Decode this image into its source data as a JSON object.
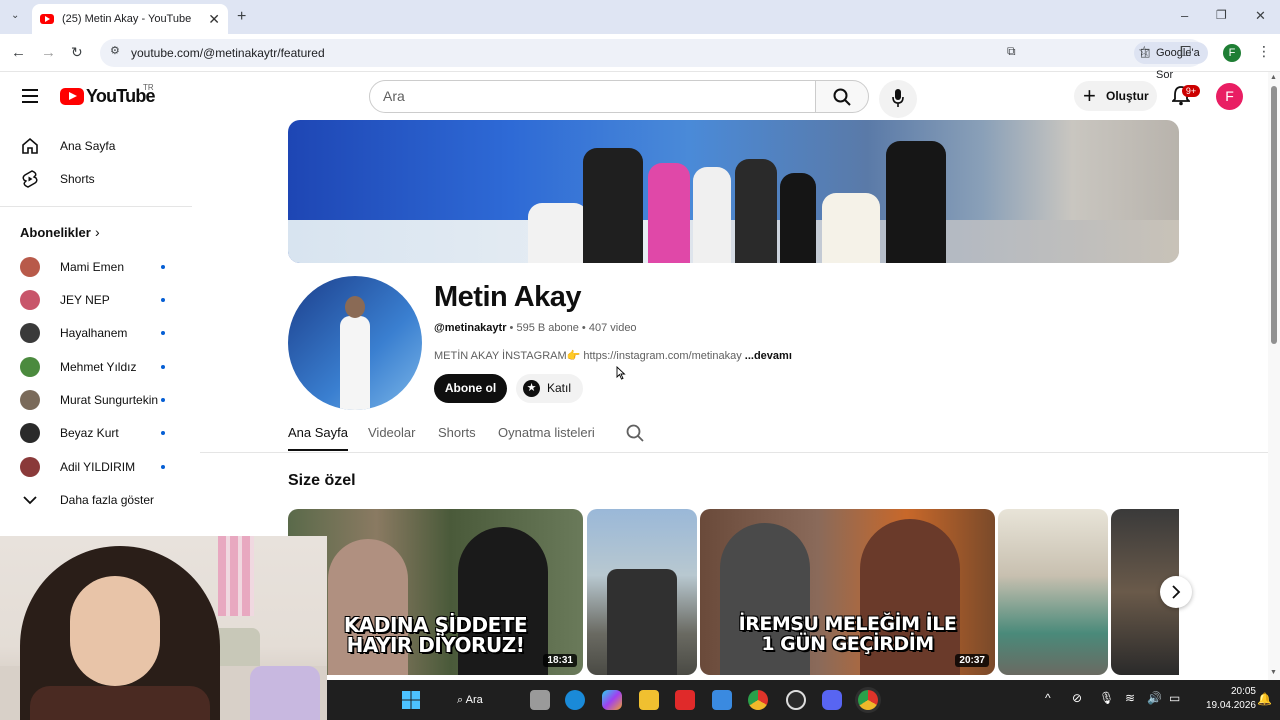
{
  "browser": {
    "tab_title": "(25) Metin Akay - YouTube",
    "url": "youtube.com/@metinakaytr/featured",
    "ask_google": "Google'a Sor",
    "profile_initial": "F"
  },
  "header": {
    "logo_text": "YouTube",
    "logo_region": "TR",
    "search_placeholder": "Ara",
    "create_label": "Oluştur",
    "notification_count": "9+",
    "avatar_initial": "F"
  },
  "sidebar": {
    "items": [
      {
        "label": "Ana Sayfa",
        "icon": "home-icon"
      },
      {
        "label": "Shorts",
        "icon": "shorts-icon"
      }
    ],
    "subscriptions_title": "Abonelikler",
    "subscriptions": [
      {
        "label": "Mami Emen",
        "color": "#b85a4a"
      },
      {
        "label": "JEY NEP",
        "color": "#c8556a"
      },
      {
        "label": "Hayalhanem",
        "color": "#3a3a3a"
      },
      {
        "label": "Mehmet Yıldız",
        "color": "#4b8a3e"
      },
      {
        "label": "Murat Sungurtekin",
        "color": "#7a6a5a"
      },
      {
        "label": "Beyaz Kurt",
        "color": "#2a2a2a"
      },
      {
        "label": "Adil YILDIRIM",
        "color": "#8a3a3a"
      }
    ],
    "show_more": "Daha fazla göster"
  },
  "channel": {
    "name": "Metin Akay",
    "handle": "@metinakaytr",
    "subscribers": "595 B abone",
    "videos": "407 video",
    "description": "METİN AKAY İNSTAGRAM👉 https://instagram.com/metinakay",
    "more": "...devamı",
    "subscribe_label": "Abone ol",
    "join_label": "Katıl"
  },
  "tabs": [
    "Ana Sayfa",
    "Videolar",
    "Shorts",
    "Oynatma listeleri"
  ],
  "section_title": "Size özel",
  "videos": [
    {
      "caption_line1": "KADINA ŞİDDETE",
      "caption_line2": "HAYIR DİYORUZ!",
      "duration": "18:31"
    },
    {
      "caption_line1": "",
      "caption_line2": "",
      "duration": ""
    },
    {
      "caption_line1": "İREMSU MELEĞİM İLE",
      "caption_line2": "1 GÜN GEÇİRDİM",
      "duration": "20:37"
    }
  ],
  "taskbar": {
    "search_label": "Ara",
    "time": "20:05",
    "date": "19.04.2026"
  }
}
